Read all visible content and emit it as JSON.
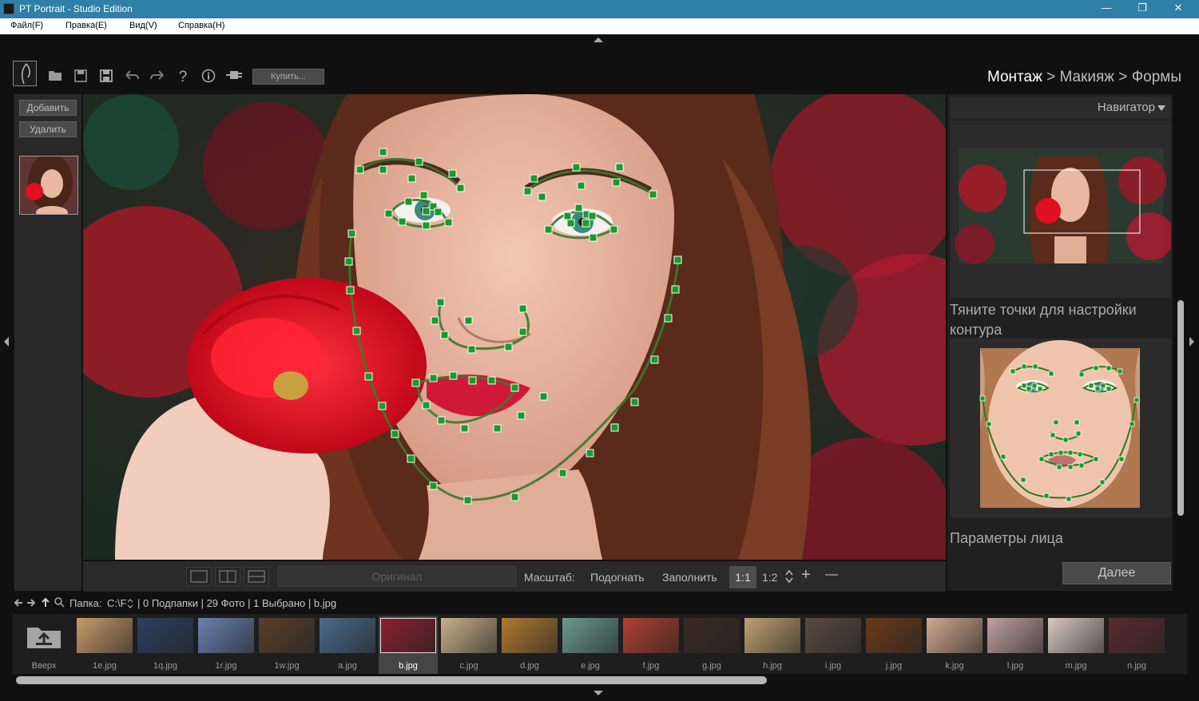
{
  "window": {
    "title": "PT Portrait - Studio Edition",
    "minimize": "—",
    "maximize": "❐",
    "close": "✕"
  },
  "menu": [
    "Файл(F)",
    "Правка(E)",
    "Вид(V)",
    "Справка(H)"
  ],
  "toolbar": {
    "buy_label": "Купить...",
    "icons": [
      "open-folder-icon",
      "save-icon",
      "save-as-icon",
      "undo-icon",
      "redo-icon",
      "help-icon",
      "info-icon",
      "plugin-icon"
    ]
  },
  "breadcrumb": {
    "step1": "Монтаж",
    "sep1": " > ",
    "step2": "Макияж",
    "sep2": " > ",
    "step3": "Формы"
  },
  "left_panel": {
    "add_label": "Добавить",
    "delete_label": "Удалить"
  },
  "bottom_bar": {
    "original_label": "Оригинал",
    "scale_label": "Масштаб:",
    "fit_label": "Подогнать",
    "fill_label": "Заполнить",
    "zoom_1_1": "1:1",
    "zoom_1_2": "1:2",
    "zoom_in": "+",
    "zoom_out": "—"
  },
  "right_panel": {
    "navigator_label": "Навигатор",
    "hint": "Тяните точки для настройки контура",
    "face_params_label": "Параметры лица",
    "next_label": "Далее"
  },
  "pathbar": {
    "folder_label": "Папка:",
    "drive": "C:\\F",
    "info": "| 0 Подпапки | 29 Фото | 1 Выбрано | b.jpg"
  },
  "filmstrip": {
    "up_label": "Вверх",
    "items": [
      {
        "name": "1e.jpg",
        "color": "#c89a6a",
        "selected": false
      },
      {
        "name": "1q.jpg",
        "color": "#2b4060",
        "selected": false
      },
      {
        "name": "1r.jpg",
        "color": "#6a80b0",
        "selected": false
      },
      {
        "name": "1w.jpg",
        "color": "#5a3e2a",
        "selected": false
      },
      {
        "name": "a.jpg",
        "color": "#4a6a8a",
        "selected": false
      },
      {
        "name": "b.jpg",
        "color": "#8a2030",
        "selected": true
      },
      {
        "name": "c.jpg",
        "color": "#c8b08a",
        "selected": false
      },
      {
        "name": "d.jpg",
        "color": "#b07a30",
        "selected": false
      },
      {
        "name": "e.jpg",
        "color": "#6a9a90",
        "selected": false
      },
      {
        "name": "f.jpg",
        "color": "#b04030",
        "selected": false
      },
      {
        "name": "g.jpg",
        "color": "#3a2a20",
        "selected": false
      },
      {
        "name": "h.jpg",
        "color": "#c0a070",
        "selected": false
      },
      {
        "name": "i.jpg",
        "color": "#5a4a40",
        "selected": false
      },
      {
        "name": "j.jpg",
        "color": "#6a3a1a",
        "selected": false
      },
      {
        "name": "k.jpg",
        "color": "#d0a890",
        "selected": false
      },
      {
        "name": "l.jpg",
        "color": "#c0a0a0",
        "selected": false
      },
      {
        "name": "m.jpg",
        "color": "#d8c8c0",
        "selected": false
      },
      {
        "name": "n.jpg",
        "color": "#5a2a30",
        "selected": false
      }
    ]
  }
}
